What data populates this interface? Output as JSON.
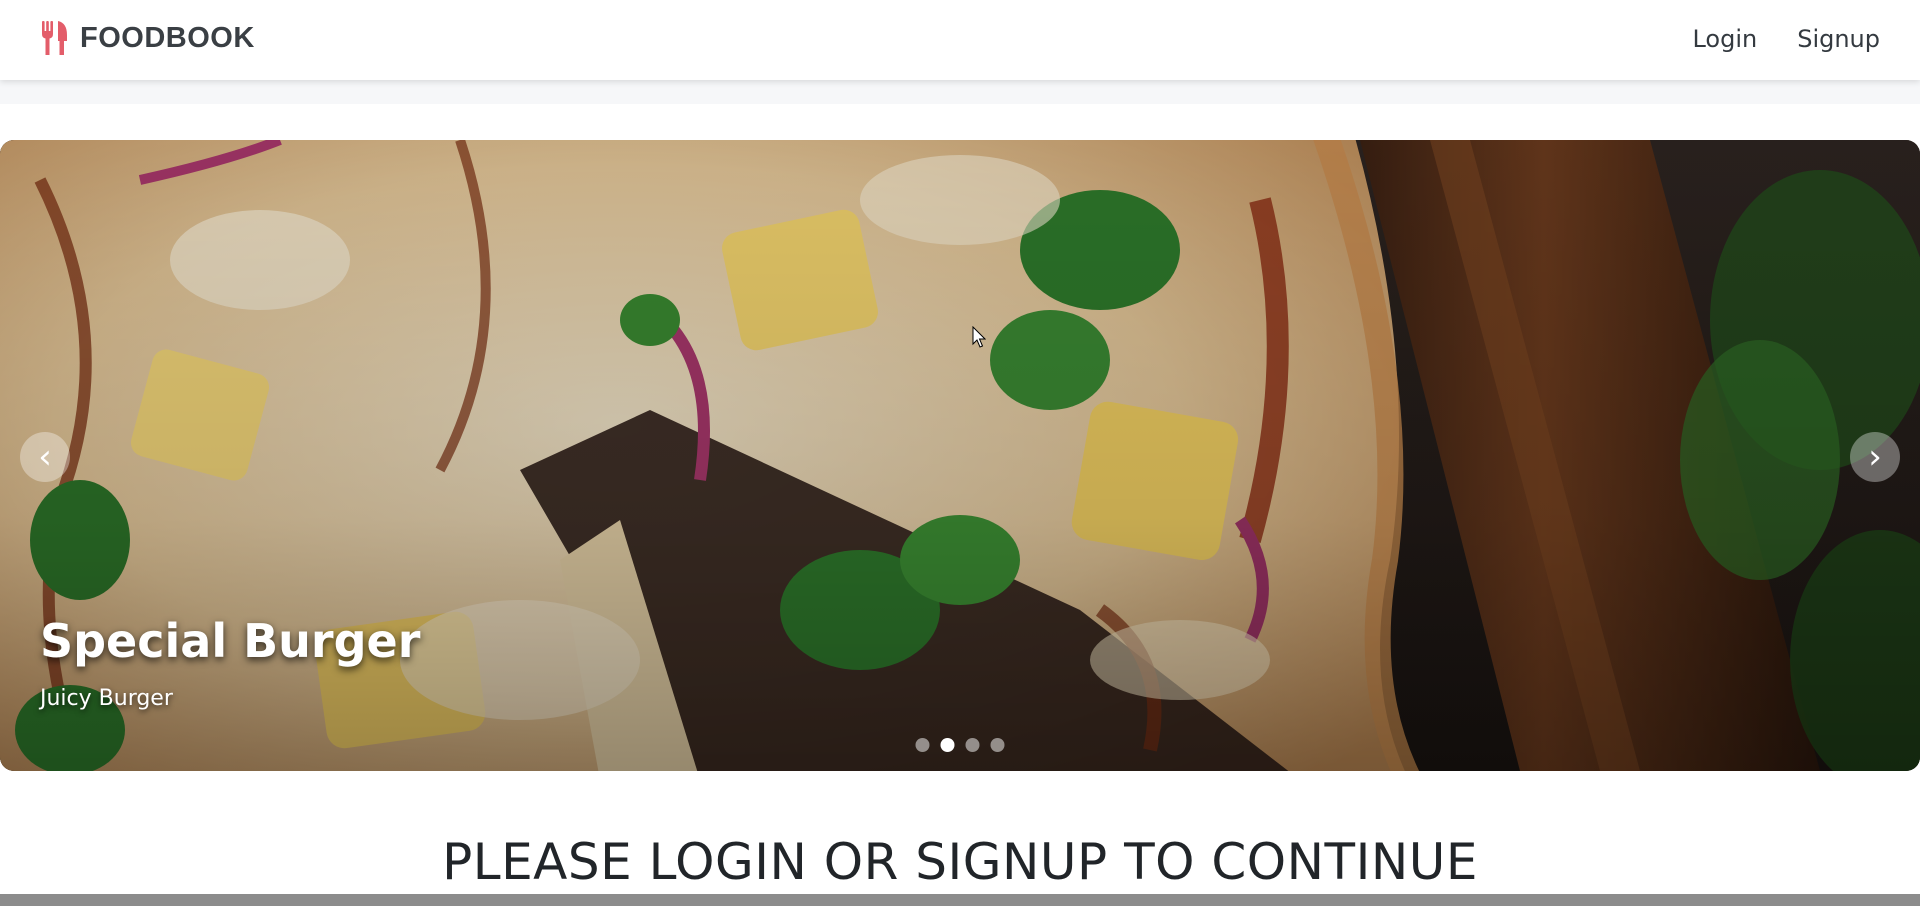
{
  "navbar": {
    "brand_name": "FOODBOOK",
    "brand_icon": "utensils-icon",
    "brand_color": "#e35d6a",
    "links": {
      "login": "Login",
      "signup": "Signup"
    }
  },
  "carousel": {
    "slide": {
      "title": "Special Burger",
      "subtitle": "Juicy Burger"
    },
    "prev_icon": "chevron-left-icon",
    "next_icon": "chevron-right-icon",
    "prev_glyph": "‹",
    "next_glyph": "›",
    "indicator_count": 4,
    "active_indicator": 2
  },
  "main": {
    "heading": "PLEASE LOGIN OR SIGNUP TO CONTINUE"
  }
}
